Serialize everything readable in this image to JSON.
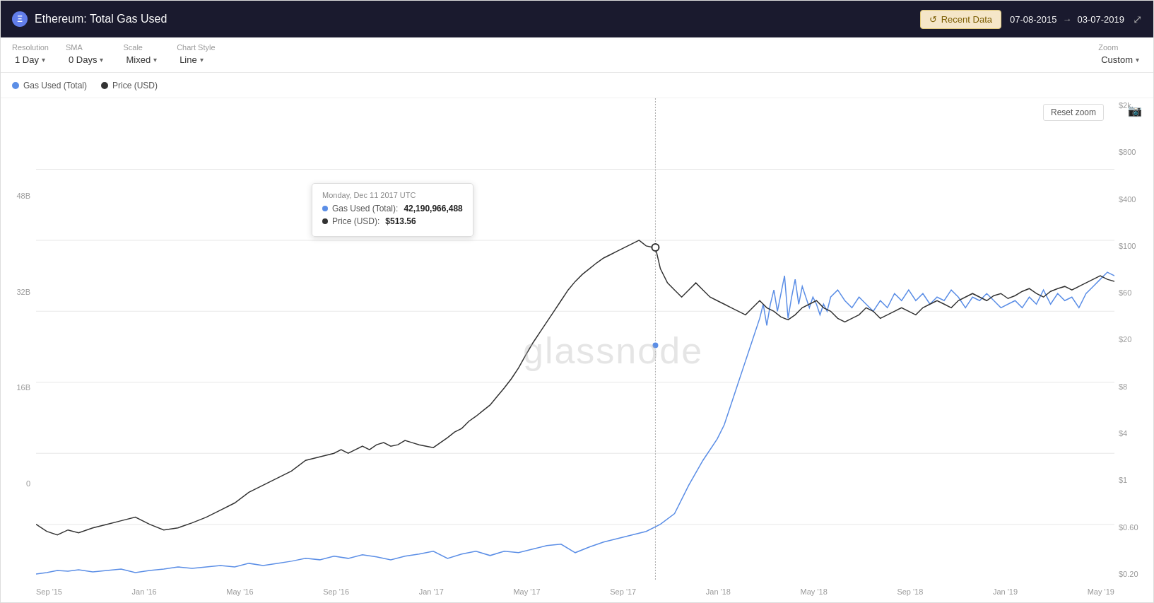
{
  "header": {
    "title": "Ethereum: Total Gas Used",
    "eth_icon": "Ξ",
    "recent_data_label": "Recent Data",
    "date_start": "07-08-2015",
    "date_end": "03-07-2019",
    "expand_icon": "⤢"
  },
  "toolbar": {
    "resolution_label": "Resolution",
    "resolution_value": "1 Day",
    "sma_label": "SMA",
    "sma_value": "0 Days",
    "scale_label": "Scale",
    "scale_value": "Mixed",
    "chart_style_label": "Chart Style",
    "chart_style_value": "Line",
    "zoom_label": "Zoom",
    "zoom_value": "Custom"
  },
  "legend": {
    "items": [
      {
        "label": "Gas Used (Total)",
        "color": "blue",
        "dot": "blue"
      },
      {
        "label": "Price (USD)",
        "color": "black",
        "dot": "black"
      }
    ]
  },
  "chart": {
    "watermark": "glassnode",
    "reset_zoom": "Reset zoom",
    "y_axis_left": [
      "48B",
      "32B",
      "16B",
      "0"
    ],
    "y_axis_right": [
      "$2k",
      "$800",
      "$400",
      "$100",
      "$60",
      "$20",
      "$8",
      "$4",
      "$1",
      "$0.60",
      "$0.20"
    ],
    "x_axis": [
      "Sep '15",
      "Jan '16",
      "May '16",
      "Sep '16",
      "Jan '17",
      "May '17",
      "Sep '17",
      "Jan '18",
      "May '18",
      "Sep '18",
      "Jan '19",
      "May '19"
    ]
  },
  "tooltip": {
    "date": "Monday, Dec 11 2017 UTC",
    "rows": [
      {
        "label": "Gas Used (Total):",
        "value": "42,190,966,488",
        "color": "blue"
      },
      {
        "label": "Price (USD):",
        "value": "$513.56",
        "color": "black"
      }
    ]
  }
}
